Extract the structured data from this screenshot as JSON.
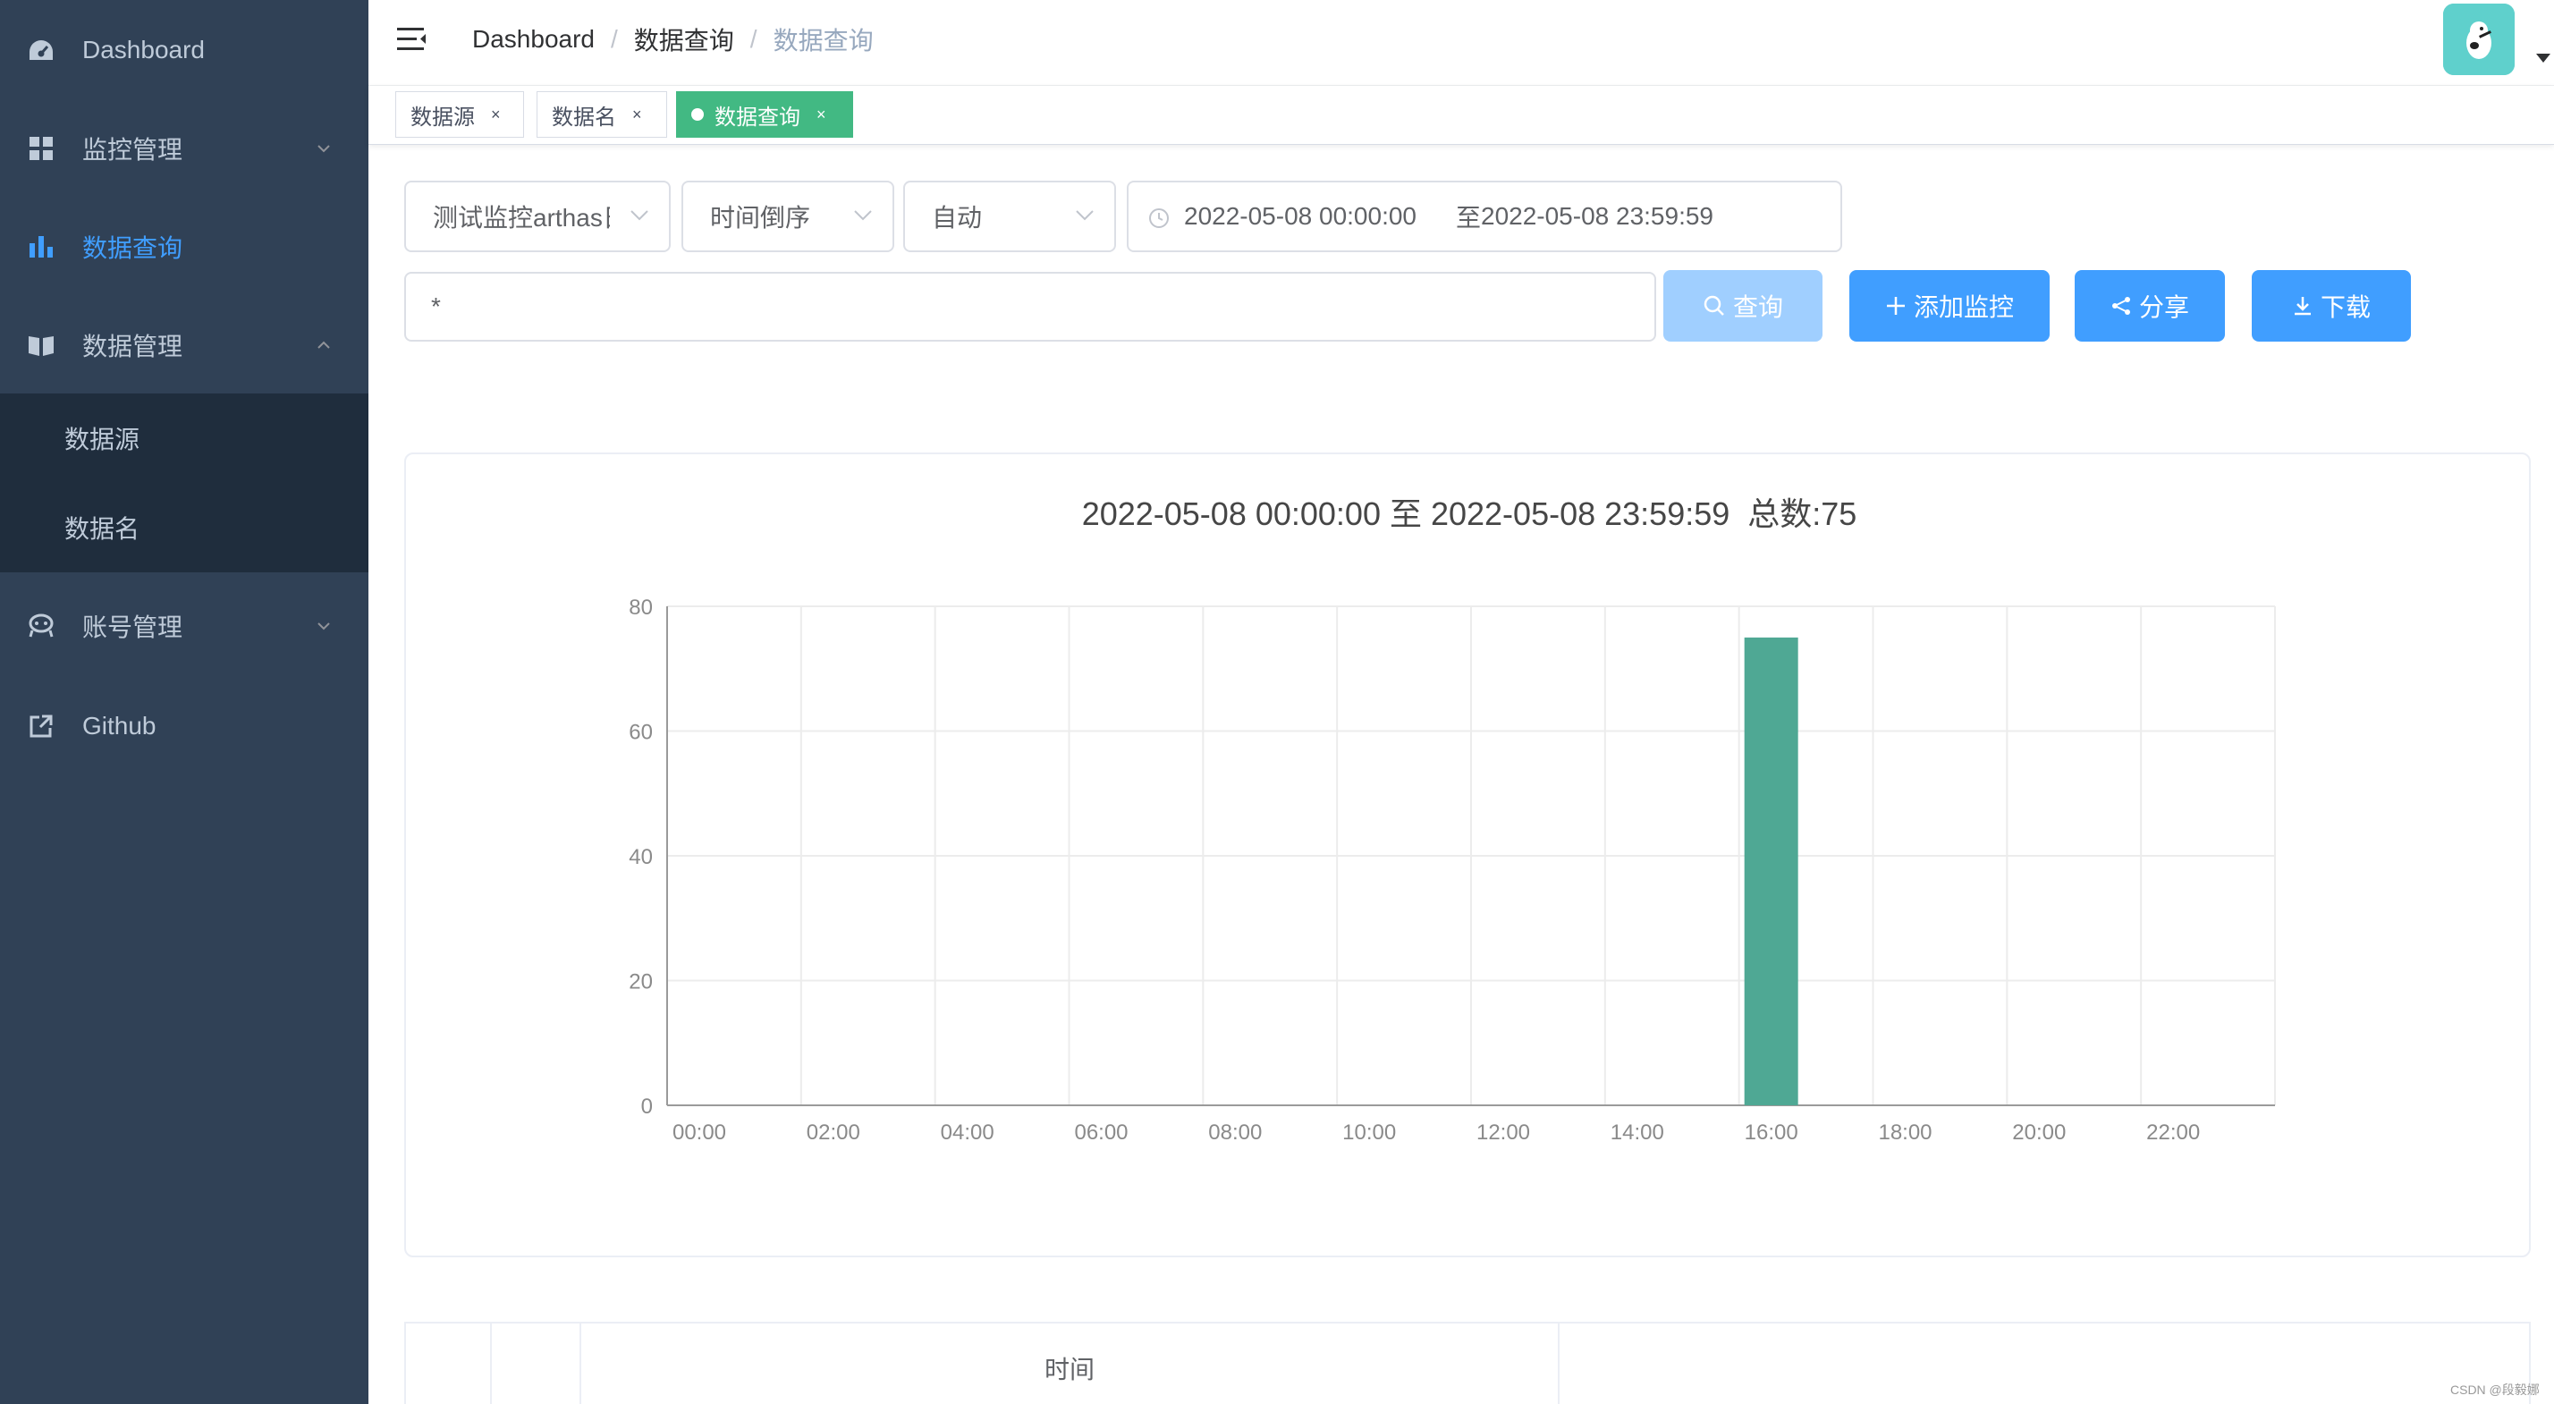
{
  "sidebar": {
    "items": [
      {
        "label": "Dashboard",
        "icon": "dashboard-icon"
      },
      {
        "label": "监控管理",
        "icon": "grid-icon"
      },
      {
        "label": "数据查询",
        "icon": "bar-chart-icon"
      },
      {
        "label": "数据管理",
        "icon": "book-icon"
      },
      {
        "label": "账号管理",
        "icon": "peoples-icon"
      },
      {
        "label": "Github",
        "icon": "external-link-icon"
      }
    ],
    "submenu": [
      {
        "label": "数据源"
      },
      {
        "label": "数据名"
      }
    ],
    "colors": {
      "background": "#304156",
      "submenu_background": "#1f2d3d",
      "text": "#bfcbd9",
      "active": "#409EFF"
    }
  },
  "navbar": {
    "breadcrumb": [
      "Dashboard",
      "数据查询",
      "数据查询"
    ],
    "breadcrumb_separator": "/"
  },
  "tags": [
    {
      "label": "数据源",
      "active": false
    },
    {
      "label": "数据名",
      "active": false
    },
    {
      "label": "数据查询",
      "active": true
    }
  ],
  "tag_close": "×",
  "filters": {
    "datasource": "测试监控arthas日志",
    "order": "时间倒序",
    "interval": "自动",
    "date_start": "2022-05-08 00:00:00",
    "date_separator": "至",
    "date_end": "2022-05-08 23:59:59",
    "query": "*"
  },
  "buttons": {
    "query": "查询",
    "add_monitor": "添加监控",
    "share": "分享",
    "download": "下载"
  },
  "chart_data": {
    "type": "bar",
    "title": "2022-05-08 00:00:00 至 2022-05-08 23:59:59  总数:75",
    "categories": [
      "00:00",
      "02:00",
      "04:00",
      "06:00",
      "08:00",
      "10:00",
      "12:00",
      "14:00",
      "16:00",
      "18:00",
      "20:00",
      "22:00"
    ],
    "bars": [
      {
        "x": "16:00",
        "value": 75
      }
    ],
    "ylim": [
      0,
      80
    ],
    "yticks": [
      0,
      20,
      40,
      60,
      80
    ],
    "grid": true,
    "bar_color": "#4fa894"
  },
  "table": {
    "headers": [
      "",
      "",
      "时间",
      ""
    ]
  },
  "watermark": "CSDN @段毅娜"
}
